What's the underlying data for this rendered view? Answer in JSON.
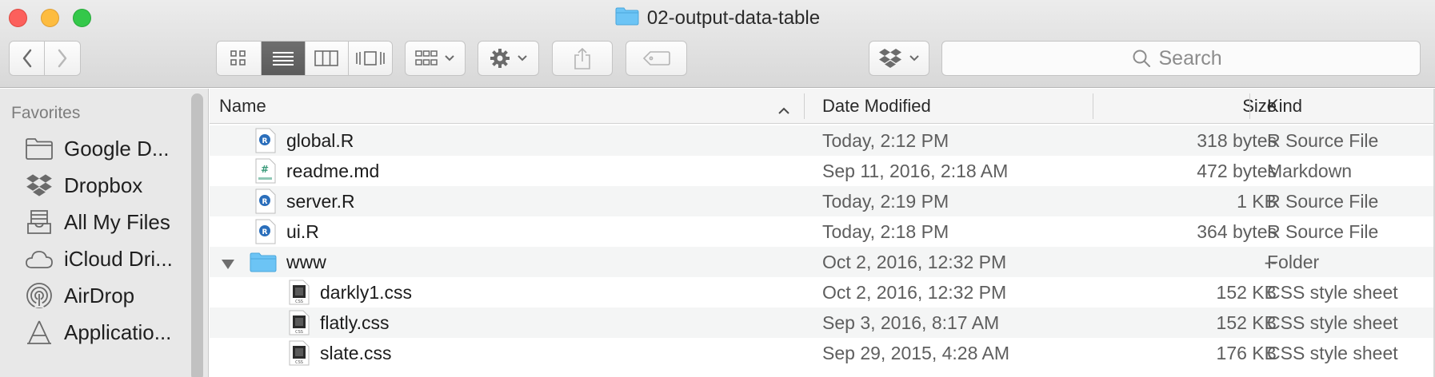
{
  "window": {
    "title": "02-output-data-table",
    "title_icon": "folder-icon"
  },
  "toolbar": {
    "nav": [
      {
        "name": "back-button",
        "icon": "chevron-left-icon"
      },
      {
        "name": "forward-button",
        "icon": "chevron-right-icon"
      }
    ],
    "view_modes": [
      "icon-view",
      "list-view",
      "column-view",
      "cover-flow-view"
    ],
    "active_view": "list-view",
    "search_placeholder": "Search"
  },
  "sidebar": {
    "heading": "Favorites",
    "items": [
      {
        "label": "Google D...",
        "icon": "folder-icon"
      },
      {
        "label": "Dropbox",
        "icon": "dropbox-icon"
      },
      {
        "label": "All My Files",
        "icon": "all-files-icon"
      },
      {
        "label": "iCloud Dri...",
        "icon": "cloud-icon"
      },
      {
        "label": "AirDrop",
        "icon": "airdrop-icon"
      },
      {
        "label": "Applicatio...",
        "icon": "applications-icon"
      }
    ]
  },
  "columns": {
    "name": "Name",
    "date": "Date Modified",
    "size": "Size",
    "kind": "Kind"
  },
  "files": [
    {
      "name": "global.R",
      "date": "Today, 2:12 PM",
      "size": "318 bytes",
      "kind": "R Source File",
      "icon": "r-file-icon",
      "indent": 0
    },
    {
      "name": "readme.md",
      "date": "Sep 11, 2016, 2:18 AM",
      "size": "472 bytes",
      "kind": "Markdown",
      "icon": "markdown-file-icon",
      "indent": 0
    },
    {
      "name": "server.R",
      "date": "Today, 2:19 PM",
      "size": "1 KB",
      "kind": "R Source File",
      "icon": "r-file-icon",
      "indent": 0
    },
    {
      "name": "ui.R",
      "date": "Today, 2:18 PM",
      "size": "364 bytes",
      "kind": "R Source File",
      "icon": "r-file-icon",
      "indent": 0
    },
    {
      "name": "www",
      "date": "Oct 2, 2016, 12:32 PM",
      "size": "--",
      "kind": "Folder",
      "icon": "folder-icon",
      "indent": 0,
      "expanded": true
    },
    {
      "name": "darkly1.css",
      "date": "Oct 2, 2016, 12:32 PM",
      "size": "152 KB",
      "kind": "CSS style sheet",
      "icon": "css-file-icon",
      "indent": 1
    },
    {
      "name": "flatly.css",
      "date": "Sep 3, 2016, 8:17 AM",
      "size": "152 KB",
      "kind": "CSS style sheet",
      "icon": "css-file-icon",
      "indent": 1
    },
    {
      "name": "slate.css",
      "date": "Sep 29, 2015, 4:28 AM",
      "size": "176 KB",
      "kind": "CSS style sheet",
      "icon": "css-file-icon",
      "indent": 1
    }
  ],
  "colors": {
    "folder": "#6cc4f5",
    "r_badge": "#2a6ebb",
    "close": "#fc605c",
    "minimize": "#fdbc40",
    "zoom": "#34c84a"
  }
}
